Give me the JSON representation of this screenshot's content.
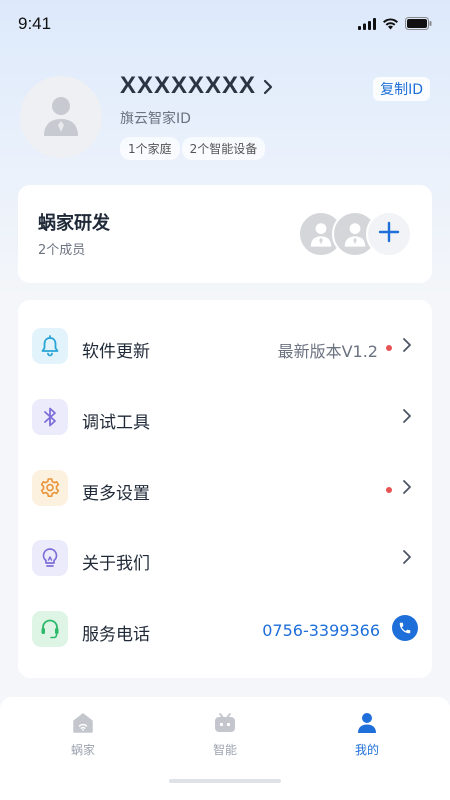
{
  "status_bar": {
    "time": "9:41"
  },
  "profile": {
    "username": "XXXXXXXX",
    "id_label": "旗云智家ID",
    "copy_button": "复制ID",
    "tags": [
      "1个家庭",
      "2个智能设备"
    ]
  },
  "family": {
    "name": "蜗家研发",
    "members": "2个成员"
  },
  "menu": {
    "items": [
      {
        "label": "软件更新",
        "value": "最新版本V1.2",
        "icon": "bell-icon",
        "badge": true
      },
      {
        "label": "调试工具",
        "value": "",
        "icon": "bluetooth-icon",
        "badge": false
      },
      {
        "label": "更多设置",
        "value": "",
        "icon": "gear-icon",
        "badge": true
      },
      {
        "label": "关于我们",
        "value": "",
        "icon": "lightbulb-icon",
        "badge": false
      },
      {
        "label": "服务电话",
        "value": "0756-3399366",
        "icon": "headset-icon",
        "badge": false
      }
    ]
  },
  "bottom_nav": {
    "items": [
      {
        "label": "蜗家",
        "icon": "home-icon",
        "active": false
      },
      {
        "label": "智能",
        "icon": "robot-icon",
        "active": false
      },
      {
        "label": "我的",
        "icon": "person-icon",
        "active": true
      }
    ]
  },
  "colors": {
    "accent": "#1e6fd9",
    "badge": "#e55353"
  }
}
